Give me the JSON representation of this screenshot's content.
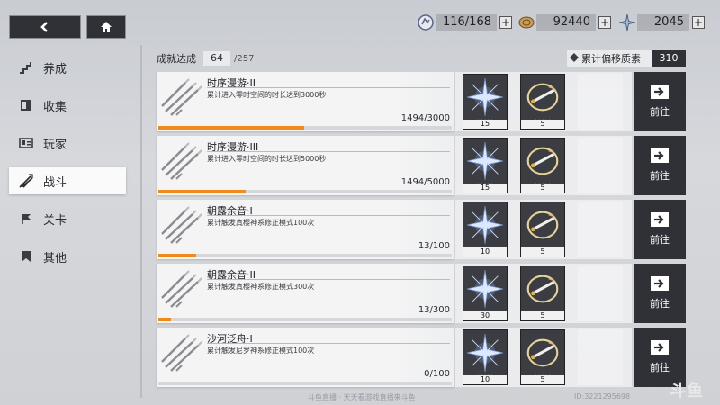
{
  "topbar": {
    "resources": [
      {
        "icon": "stamina-icon",
        "value": "116/168"
      },
      {
        "icon": "coin-icon",
        "value": "92440"
      },
      {
        "icon": "crystal-icon",
        "value": "2045"
      }
    ],
    "plus_label": "+"
  },
  "sidebar": {
    "items": [
      {
        "label": "养成",
        "icon": "stairs-icon"
      },
      {
        "label": "收集",
        "icon": "book-icon"
      },
      {
        "label": "玩家",
        "icon": "id-card-icon"
      },
      {
        "label": "战斗",
        "icon": "swords-icon",
        "active": true
      },
      {
        "label": "关卡",
        "icon": "flag-icon"
      },
      {
        "label": "其他",
        "icon": "bookmark-icon"
      }
    ]
  },
  "summary": {
    "label": "成就达成",
    "count": "64",
    "total": "/257"
  },
  "bias": {
    "label": "累计偏移质素",
    "value": "310"
  },
  "achievements": [
    {
      "title": "时序漫游·II",
      "desc": "累计进入零时空间的时长达到3000秒",
      "progress": "1494/3000",
      "fraction": 0.498,
      "rewards": [
        {
          "qty": "15"
        },
        {
          "qty": "5"
        }
      ],
      "goto": "前往"
    },
    {
      "title": "时序漫游·III",
      "desc": "累计进入零时空间的时长达到5000秒",
      "progress": "1494/5000",
      "fraction": 0.299,
      "rewards": [
        {
          "qty": "15"
        },
        {
          "qty": "5"
        }
      ],
      "goto": "前往"
    },
    {
      "title": "朝露余音·I",
      "desc": "累计触发真樱神系修正模式100次",
      "progress": "13/100",
      "fraction": 0.13,
      "rewards": [
        {
          "qty": "10"
        },
        {
          "qty": "5"
        }
      ],
      "goto": "前往"
    },
    {
      "title": "朝露余音·II",
      "desc": "累计触发真樱神系修正模式300次",
      "progress": "13/300",
      "fraction": 0.043,
      "rewards": [
        {
          "qty": "30"
        },
        {
          "qty": "5"
        }
      ],
      "goto": "前往"
    },
    {
      "title": "沙河泛舟·I",
      "desc": "累计触发尼罗神系修正模式100次",
      "progress": "0/100",
      "fraction": 0.0,
      "rewards": [
        {
          "qty": "10"
        },
        {
          "qty": "5"
        }
      ],
      "goto": "前往"
    }
  ],
  "watermark": {
    "left": "斗鱼直播 · 天天看游戏直播来斗鱼",
    "right": "ID:3221295698"
  },
  "logo": "斗鱼",
  "colors": {
    "accent": "#f08a1c",
    "dark": "#2f3136",
    "star": "#f4b32a"
  }
}
